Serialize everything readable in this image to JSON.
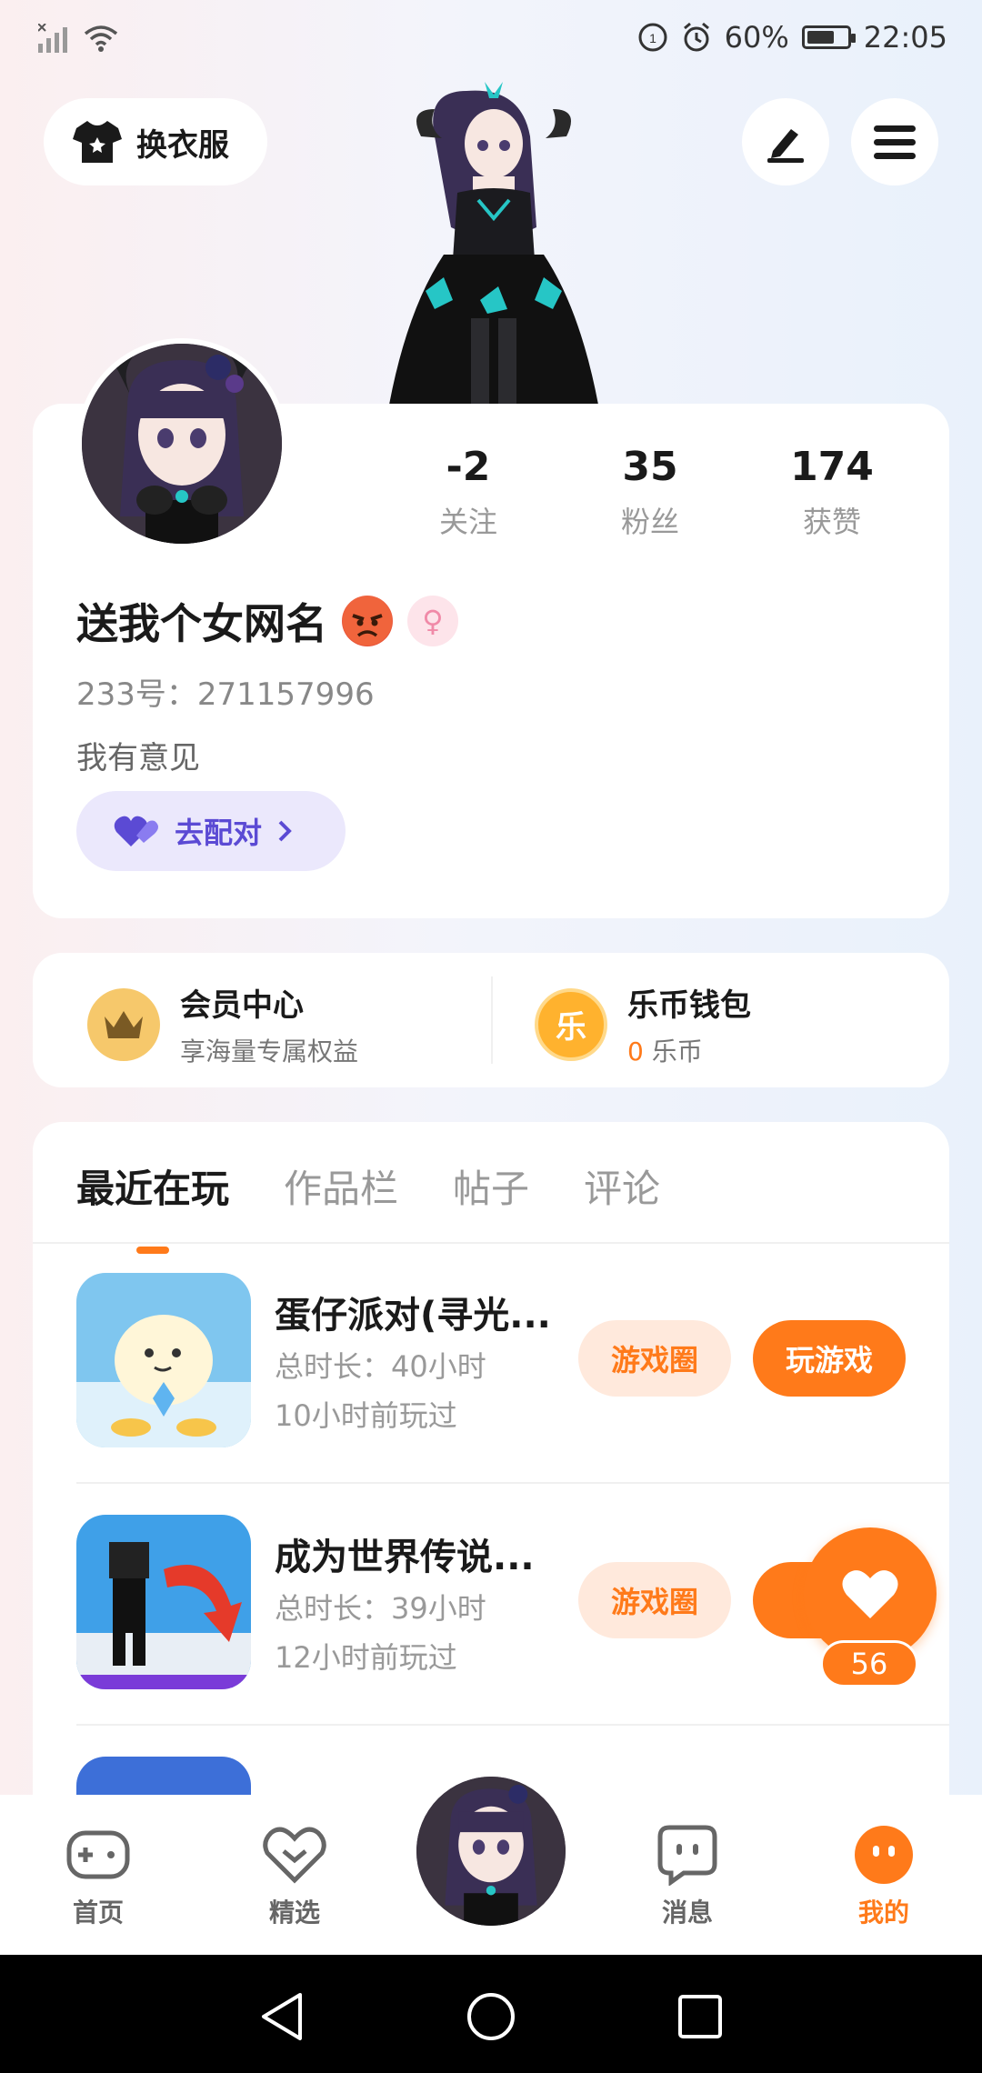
{
  "status_bar": {
    "battery_percent": "60%",
    "time": "22:05"
  },
  "header": {
    "outfit_button": "换衣服"
  },
  "profile": {
    "stats": [
      {
        "value": "-2",
        "label": "关注"
      },
      {
        "value": "35",
        "label": "粉丝"
      },
      {
        "value": "174",
        "label": "获赞"
      }
    ],
    "username": "送我个女网名",
    "uid": "233号：271157996",
    "bio": "我有意见",
    "match_button": "去配对"
  },
  "wallet": {
    "vip": {
      "title": "会员中心",
      "subtitle": "享海量专属权益"
    },
    "coins": {
      "title": "乐币钱包",
      "amount": "0",
      "unit": "乐币",
      "icon_char": "乐"
    }
  },
  "tabs": [
    "最近在玩",
    "作品栏",
    "帖子",
    "评论"
  ],
  "games": [
    {
      "title": "蛋仔派对(寻光...",
      "duration": "总时长：40小时",
      "last_played": "10小时前玩过",
      "circle_button": "游戏圈",
      "play_button": "玩游戏"
    },
    {
      "title": "成为世界传说...",
      "duration": "总时长：39小时",
      "last_played": "12小时前玩过",
      "circle_button": "游戏圈",
      "play_button": "玩"
    }
  ],
  "like_fab": {
    "count": "56"
  },
  "bottom_nav": [
    {
      "label": "首页",
      "icon": "gamepad-icon"
    },
    {
      "label": "精选",
      "icon": "heart-badge-icon"
    },
    {
      "label": "消息",
      "icon": "chat-icon"
    },
    {
      "label": "我的",
      "icon": "profile-face-icon"
    }
  ],
  "colors": {
    "accent": "#ff7a1a",
    "match_purple": "#5b4ad4"
  }
}
